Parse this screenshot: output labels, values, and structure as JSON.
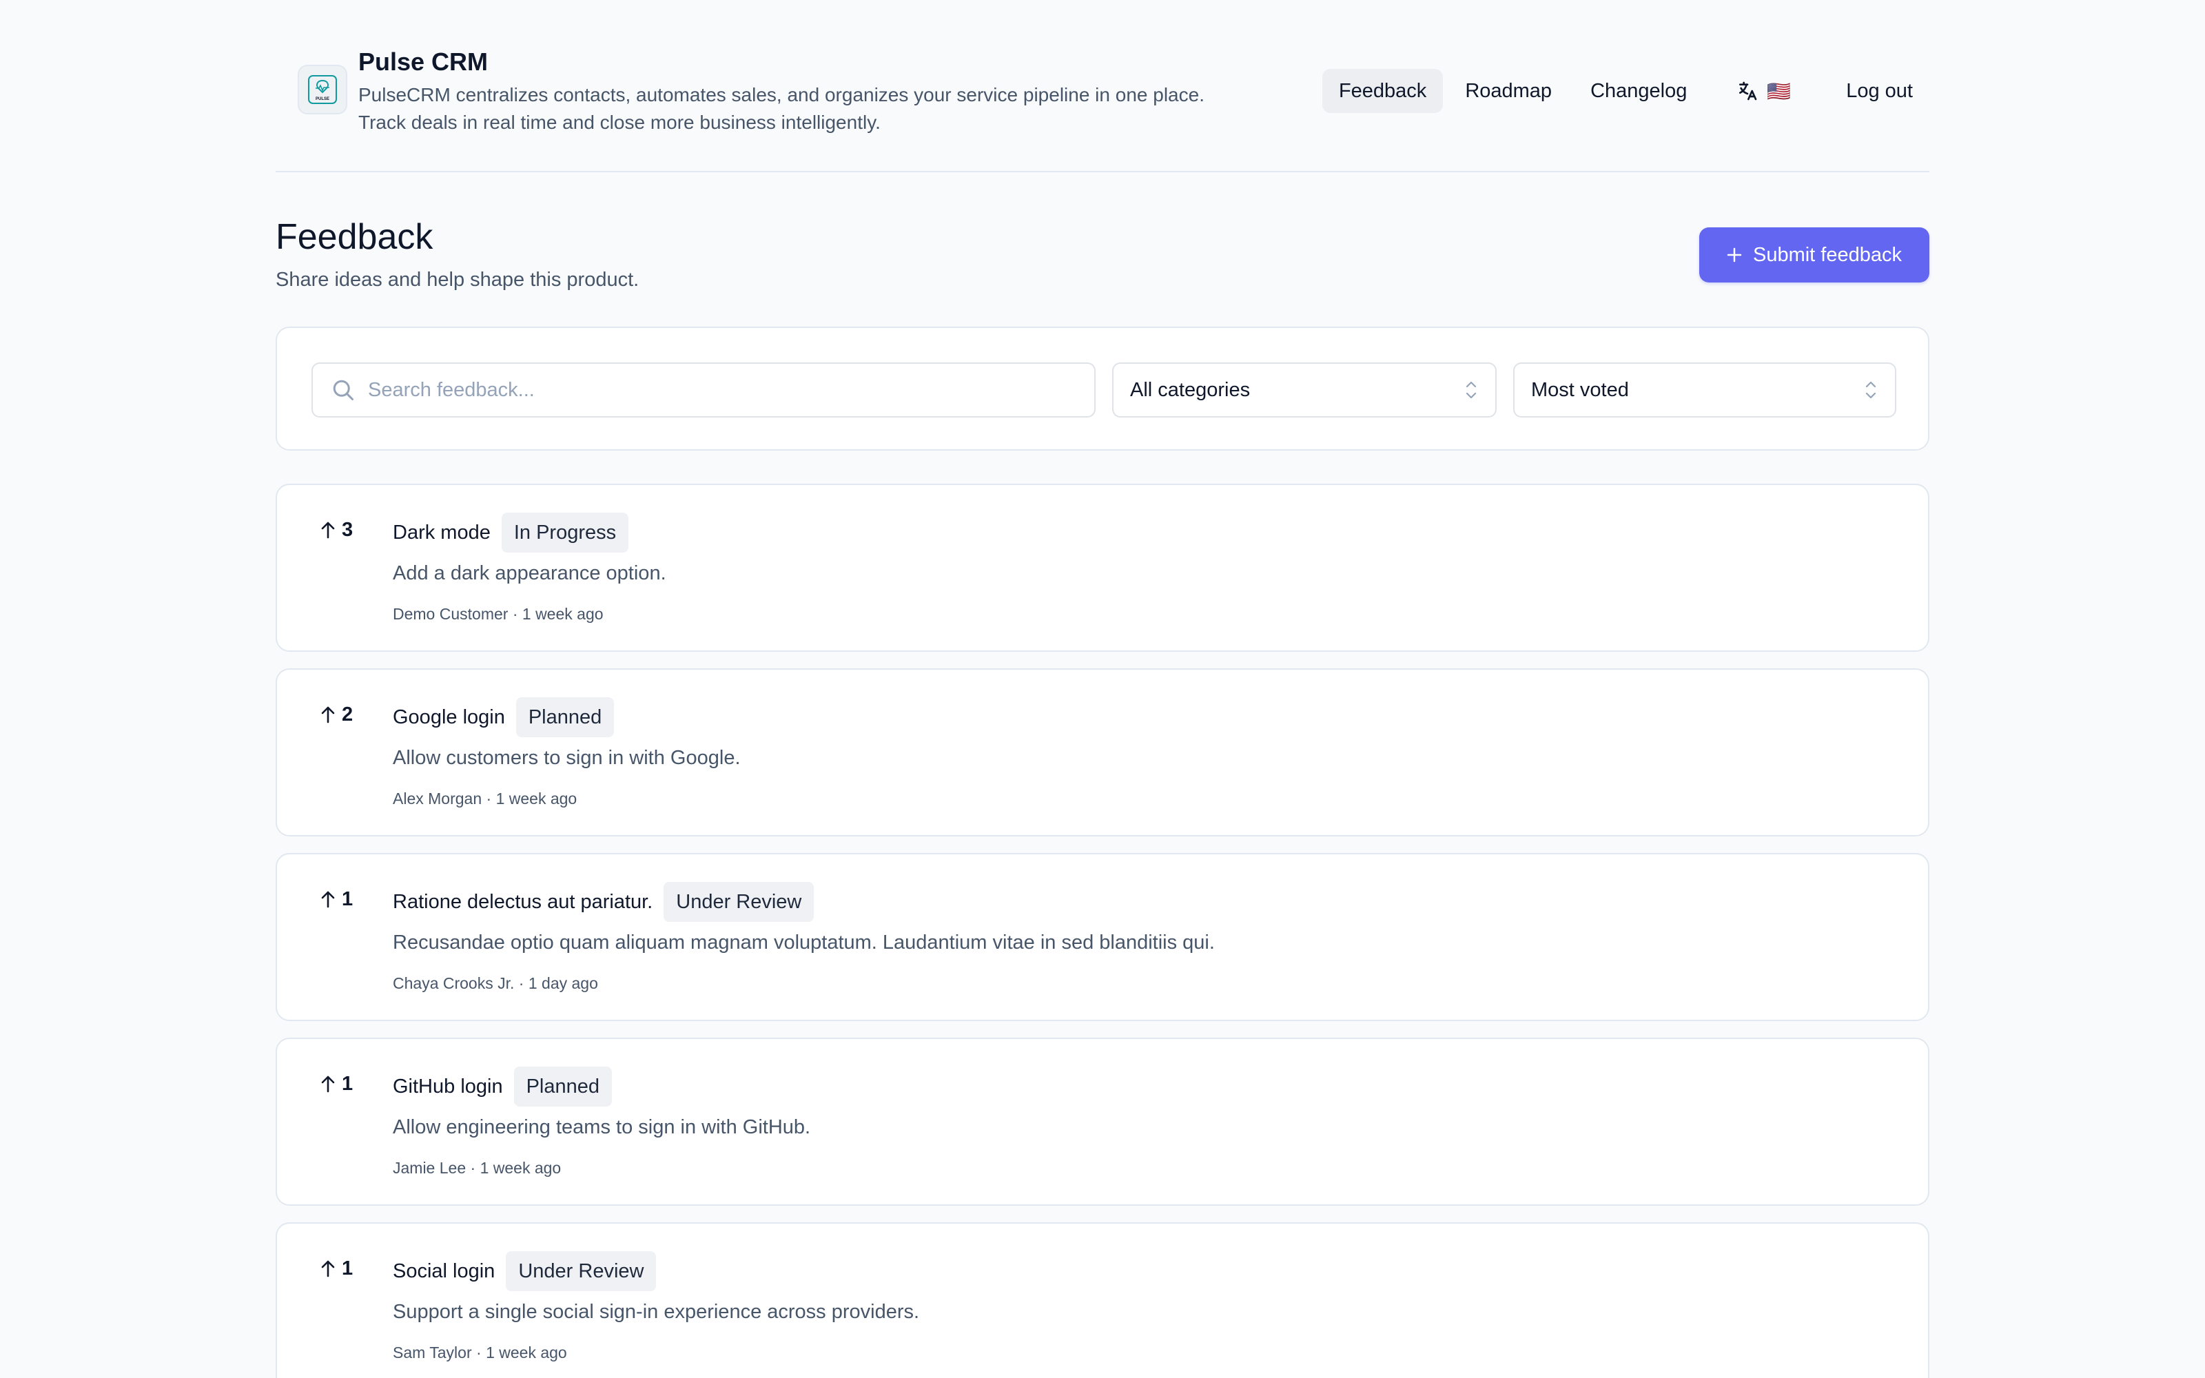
{
  "header": {
    "app_name": "Pulse CRM",
    "tagline_line1": "PulseCRM centralizes contacts, automates sales, and organizes your service pipeline in one place.",
    "tagline_line2": "Track deals in real time and close more business intelligently.",
    "logo_text": "PULSE",
    "nav": [
      {
        "label": "Feedback",
        "active": true
      },
      {
        "label": "Roadmap",
        "active": false
      },
      {
        "label": "Changelog",
        "active": false
      }
    ],
    "language_icon": "translate-icon",
    "flag": "🇺🇸",
    "logout_label": "Log out"
  },
  "page": {
    "title": "Feedback",
    "subtitle": "Share ideas and help shape this product.",
    "submit_label": "Submit feedback"
  },
  "filters": {
    "search_placeholder": "Search feedback...",
    "search_value": "",
    "category_selected": "All categories",
    "sort_selected": "Most voted"
  },
  "feedback": [
    {
      "votes": "3",
      "title": "Dark mode",
      "status": "In Progress",
      "description": "Add a dark appearance option.",
      "author": "Demo Customer",
      "time": "1 week ago"
    },
    {
      "votes": "2",
      "title": "Google login",
      "status": "Planned",
      "description": "Allow customers to sign in with Google.",
      "author": "Alex Morgan",
      "time": "1 week ago"
    },
    {
      "votes": "1",
      "title": "Ratione delectus aut pariatur.",
      "status": "Under Review",
      "description": "Recusandae optio quam aliquam magnam voluptatum. Laudantium vitae in sed blanditiis qui.",
      "author": "Chaya Crooks Jr.",
      "time": "1 day ago"
    },
    {
      "votes": "1",
      "title": "GitHub login",
      "status": "Planned",
      "description": "Allow engineering teams to sign in with GitHub.",
      "author": "Jamie Lee",
      "time": "1 week ago"
    },
    {
      "votes": "1",
      "title": "Social login",
      "status": "Under Review",
      "description": "Support a single social sign-in experience across providers.",
      "author": "Sam Taylor",
      "time": "1 week ago"
    }
  ],
  "colors": {
    "accent": "#6366f1",
    "background": "#f8fafc",
    "card": "#ffffff",
    "border": "#e2e8f0",
    "badge": "#f0f1f4",
    "muted_text": "#475569"
  }
}
